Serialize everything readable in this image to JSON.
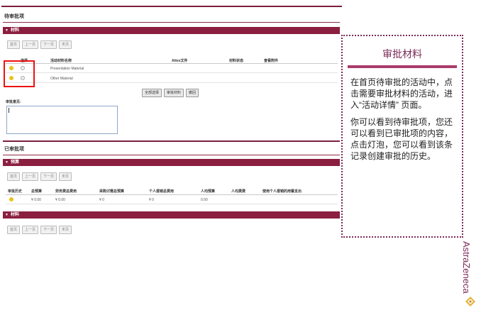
{
  "pending": {
    "title": "待审批项",
    "materials_bar": "材料",
    "pager": [
      "首页",
      "上一页",
      "下一页",
      "末页"
    ],
    "columns": [
      "选择",
      "活动材料名称",
      "Attex文件",
      "材料状态",
      "查看附件"
    ],
    "rows": [
      {
        "name": "Presentation Material"
      },
      {
        "name": "Other Material"
      }
    ],
    "actions": [
      "全部选择",
      "审批材料",
      "撤回"
    ],
    "comment_label": "审批意见:"
  },
  "approved": {
    "title": "已审批项",
    "budget_bar": "预算",
    "pager": [
      "首页",
      "上一页",
      "下一页",
      "末页"
    ],
    "columns": [
      "审批历史",
      "总预算",
      "劳务费总费用",
      "采购讨需总预算",
      "个人报销总费用",
      "人均预算",
      "人均费费",
      "使用个人报销的用餐支出"
    ],
    "row": [
      "¥ 0.00",
      "¥ 0.00",
      "¥ 0",
      "¥ 0",
      "0.00"
    ],
    "materials_bar": "材料",
    "pager2": [
      "首页",
      "上一页",
      "下一页",
      "末页"
    ]
  },
  "callout": {
    "title": "审批材料",
    "para1": "在首页待审批的活动中，点击需要审批材料的活动，进入“活动详情” 页面。",
    "para2": "你可以看到待审批项，您还可以看到已审批项的内容，点击灯泡，您可以看到该条记录创建审批的历史。"
  },
  "brand": {
    "name": "AstraZeneca",
    "color": "#7b2a57"
  },
  "colors": {
    "bar": "#8b1f3f",
    "accent": "#7b2a57",
    "bulb": "#e9c21b",
    "highlight": "#e11111"
  }
}
